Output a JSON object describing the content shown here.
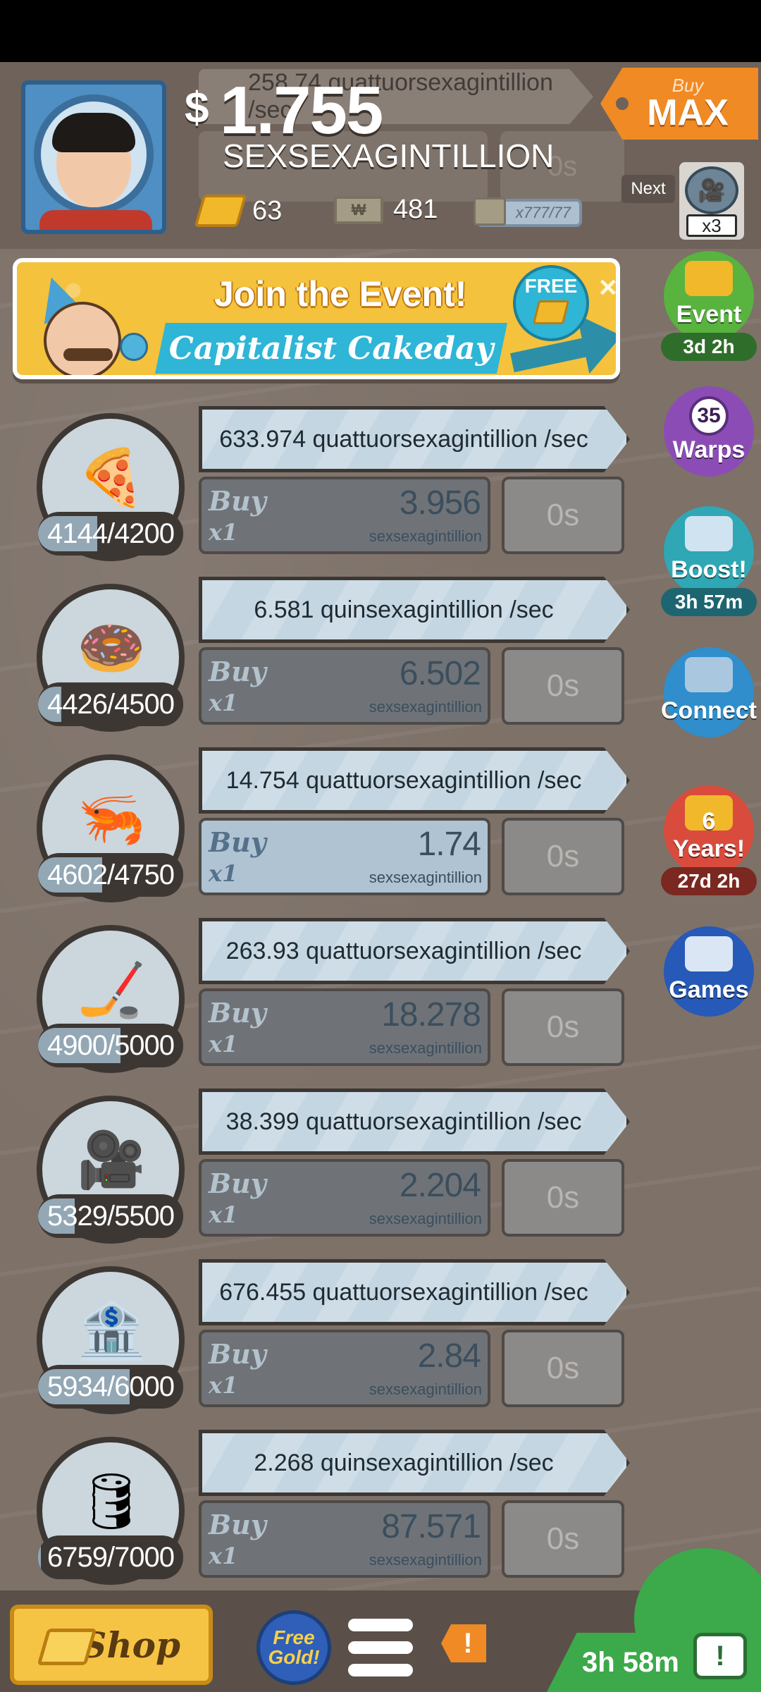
{
  "header": {
    "ghost_rate": "258.74 quattuorsexagintillion /sec",
    "ghost_time": "0s",
    "money_symbol": "$",
    "money_amount": "1.755",
    "money_unit": "SEXSEXAGINTILLION",
    "gold_count": "63",
    "megabucks_count": "481",
    "megabill_value": "x777/77",
    "buy_max": {
      "small": "Buy",
      "big": "MAX"
    },
    "next": {
      "label": "Next",
      "multiplier": "x3"
    }
  },
  "event_banner": {
    "title": "Join the Event!",
    "subtitle": "Capitalist Cakeday",
    "free_label": "FREE",
    "close": "×"
  },
  "side_buttons": [
    {
      "id": "event",
      "label": "Event",
      "timer": "3d 2h",
      "color": "#58b33f",
      "timer_color": "#2f6d2a"
    },
    {
      "id": "warps",
      "label": "Warps",
      "badge": "35",
      "color": "#8b4db5",
      "timer_color": "#5a2e7a"
    },
    {
      "id": "boost",
      "label": "Boost!",
      "timer": "3h 57m",
      "color": "#2fa7b5",
      "timer_color": "#1d6571"
    },
    {
      "id": "connect",
      "label": "Connect",
      "color": "#2f8ecb"
    },
    {
      "id": "six-years",
      "label": "6 Years!",
      "timer": "27d 2h",
      "color": "#d94c3d",
      "timer_color": "#7a2820"
    },
    {
      "id": "games",
      "label": "Games",
      "color": "#2659b8"
    }
  ],
  "businesses": [
    {
      "icon": "🍕",
      "name": "pizza",
      "owned": "4144",
      "target": "4200",
      "progress": 0.41,
      "rate": "633.974 quattuorsexagintillion /sec",
      "buy": "Buy",
      "mult": "x1",
      "cost": "3.956",
      "cost_unit": "sexsexagintillion",
      "time": "0s",
      "affordable": false
    },
    {
      "icon": "🍩",
      "name": "donut",
      "owned": "4426",
      "target": "4500",
      "progress": 0.16,
      "rate": "6.581 quinsexagintillion /sec",
      "buy": "Buy",
      "mult": "x1",
      "cost": "6.502",
      "cost_unit": "sexsexagintillion",
      "time": "0s",
      "affordable": false
    },
    {
      "icon": "🦐",
      "name": "shrimp",
      "owned": "4602",
      "target": "4750",
      "progress": 0.44,
      "rate": "14.754 quattuorsexagintillion /sec",
      "buy": "Buy",
      "mult": "x1",
      "cost": "1.74",
      "cost_unit": "sexsexagintillion",
      "time": "0s",
      "affordable": true
    },
    {
      "icon": "🏒",
      "name": "hockey",
      "owned": "4900",
      "target": "5000",
      "progress": 0.57,
      "rate": "263.93 quattuorsexagintillion /sec",
      "buy": "Buy",
      "mult": "x1",
      "cost": "18.278",
      "cost_unit": "sexsexagintillion",
      "time": "0s",
      "affordable": false
    },
    {
      "icon": "🎥",
      "name": "movie",
      "owned": "5329",
      "target": "5500",
      "progress": 0.25,
      "rate": "38.399 quattuorsexagintillion /sec",
      "buy": "Buy",
      "mult": "x1",
      "cost": "2.204",
      "cost_unit": "sexsexagintillion",
      "time": "0s",
      "affordable": false
    },
    {
      "icon": "🏦",
      "name": "bank",
      "owned": "5934",
      "target": "6000",
      "progress": 0.63,
      "rate": "676.455 quattuorsexagintillion /sec",
      "buy": "Buy",
      "mult": "x1",
      "cost": "2.84",
      "cost_unit": "sexsexagintillion",
      "time": "0s",
      "affordable": false
    },
    {
      "icon": "🛢",
      "name": "oil",
      "owned": "6759",
      "target": "7000",
      "progress": 0.02,
      "rate": "2.268 quinsexagintillion /sec",
      "buy": "Buy",
      "mult": "x1",
      "cost": "87.571",
      "cost_unit": "sexsexagintillion",
      "time": "0s",
      "affordable": false
    }
  ],
  "bottom_bar": {
    "shop": "Shop",
    "free_gold": "Free Gold!",
    "alert": "!",
    "timer": "3h 58m",
    "tv_alert": "!"
  }
}
